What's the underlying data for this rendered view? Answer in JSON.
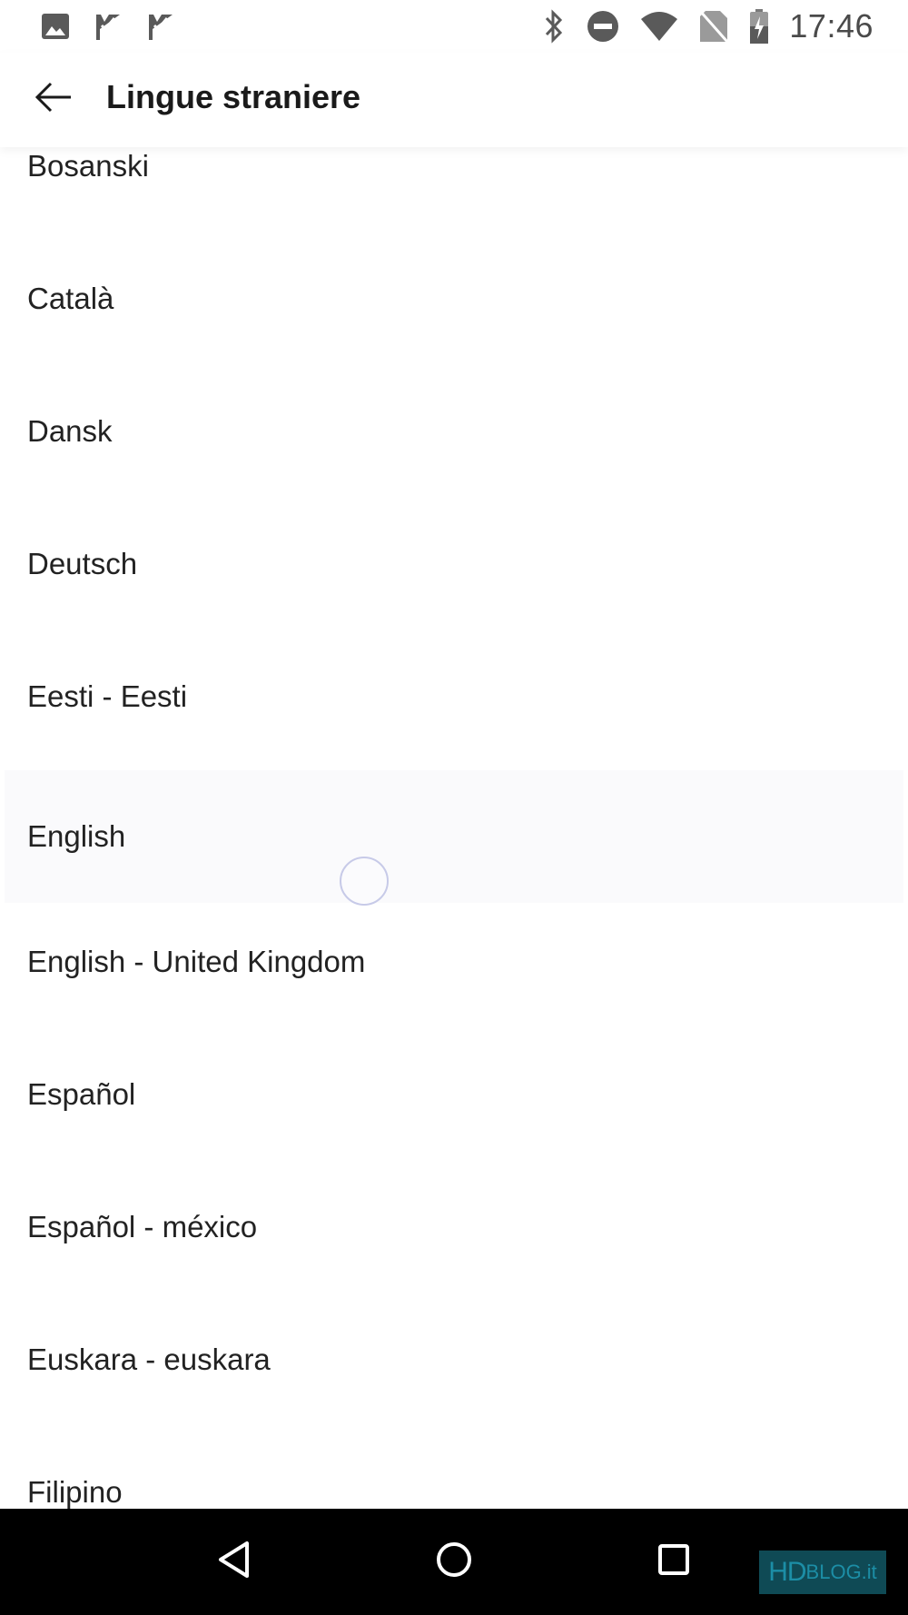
{
  "status_bar": {
    "time": "17:46",
    "left_icons": [
      "image-icon",
      "check-flag-icon",
      "check-flag-icon"
    ],
    "right_icons": [
      "bluetooth-icon",
      "do-not-disturb-icon",
      "wifi-icon",
      "no-sim-icon",
      "battery-charging-icon"
    ]
  },
  "app_bar": {
    "title": "Lingue straniere",
    "back_icon": "arrow-left-icon"
  },
  "languages": [
    "Bosanski",
    "Català",
    "Dansk",
    "Deutsch",
    "Eesti - Eesti",
    "English",
    "English - United Kingdom",
    "Español",
    "Español - méxico",
    "Euskara - euskara",
    "Filipino"
  ],
  "highlighted_item": "English",
  "nav_bar": {
    "icons": [
      "back-triangle-icon",
      "home-circle-icon",
      "recents-square-icon"
    ]
  },
  "watermark": {
    "hd": "HD",
    "blog": "BLOG.it"
  },
  "colors": {
    "background": "#ffffff",
    "nav_bar": "#000000",
    "watermark_bg": "#0f4a55",
    "watermark_text": "#1c8ea6",
    "ripple": "#c7cae8"
  }
}
